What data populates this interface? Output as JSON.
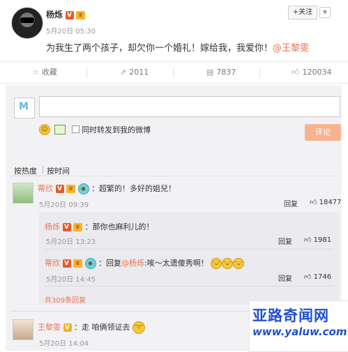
{
  "post": {
    "username": "杨烁",
    "verified_badge": "V",
    "member_badge": "♛",
    "time": "5月20日 05:30",
    "follow_label": "+关注",
    "text_main": "为我生了两个孩子，却欠你一个婚礼！嫁给我，我爱你！",
    "text_mention": "@王黎雯"
  },
  "actions": {
    "favorite": "收藏",
    "repost_count": "2011",
    "comment_count": "7837",
    "like_count": "120034"
  },
  "composer": {
    "repost_checkbox_label": "同时转发到我的微博",
    "submit_label": "评论"
  },
  "sort": {
    "by_hot": "按热度",
    "by_time": "按时间"
  },
  "comments": [
    {
      "name": "蒂欣",
      "text": "：超繁的！多好的姐兒！",
      "time": "5月20日 09:39",
      "reply_label": "回复",
      "like_count": "18477",
      "replies": [
        {
          "name": "杨烁",
          "text": "：那你也麻利儿的！",
          "time": "5月20日 13:23",
          "reply_label": "回复",
          "like_count": "1981"
        },
        {
          "name": "蒂欣",
          "text_prefix": "：回复",
          "mention": "@杨烁",
          "text_suffix": ":唉～太遗傻秀啊！",
          "time": "5月20日 14:45",
          "reply_label": "回复",
          "like_count": "1746"
        }
      ],
      "more_replies": "共309条回复"
    },
    {
      "name": "王黎雯",
      "text": "：走 咱俩领证去",
      "time": "5月20日 14:04"
    }
  ],
  "watermark": {
    "title": "亚路奇闻网",
    "url": "www.yaluw.com"
  },
  "colors": {
    "accent": "#eb7350",
    "verified": "#e85a2b",
    "watermark": "#1f4fd0"
  }
}
